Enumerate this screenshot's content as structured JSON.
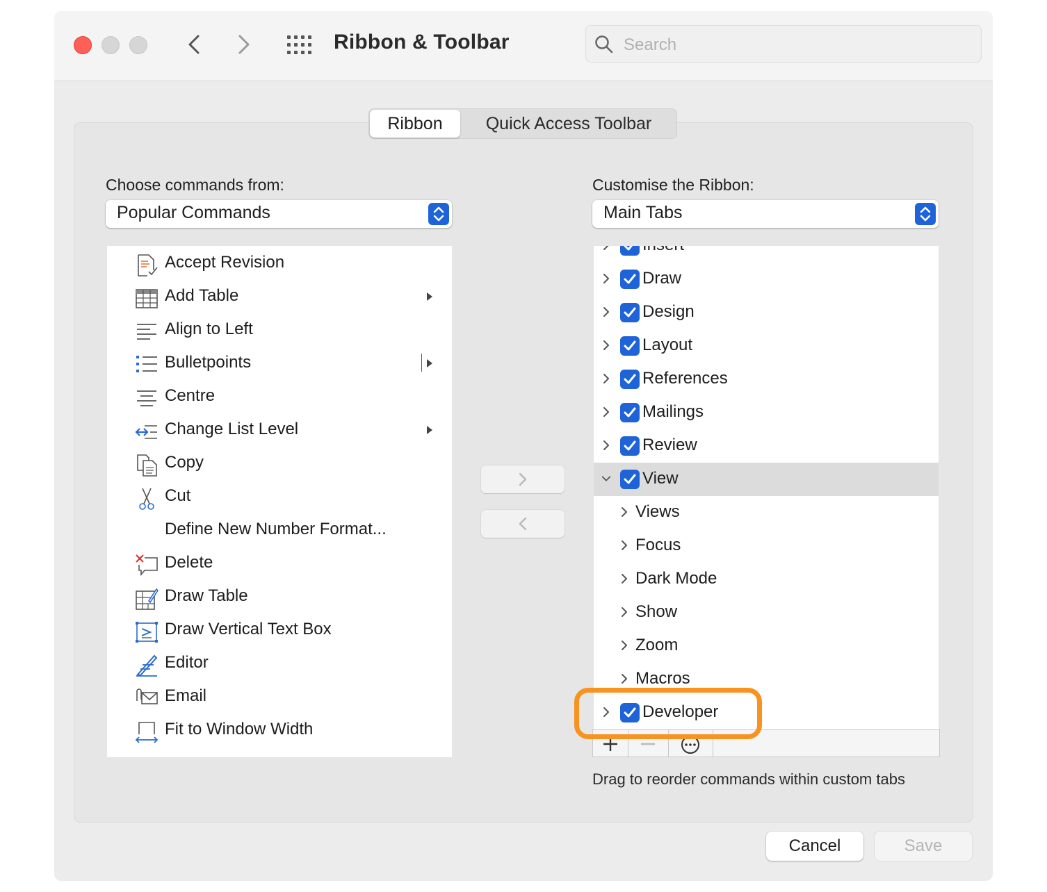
{
  "window": {
    "title": "Ribbon & Toolbar"
  },
  "search": {
    "placeholder": "Search"
  },
  "tabs": [
    {
      "label": "Ribbon",
      "active": true
    },
    {
      "label": "Quick Access Toolbar",
      "active": false
    }
  ],
  "left": {
    "label": "Choose commands from:",
    "dropdown_value": "Popular Commands",
    "commands": [
      {
        "label": "Accept Revision",
        "icon": "accept-revision-icon"
      },
      {
        "label": "Add Table",
        "icon": "table-icon",
        "submenu": true
      },
      {
        "label": "Align to Left",
        "icon": "align-left-icon"
      },
      {
        "label": "Bulletpoints",
        "icon": "bullets-icon",
        "split_submenu": true
      },
      {
        "label": "Centre",
        "icon": "align-center-icon"
      },
      {
        "label": "Change List Level",
        "icon": "list-level-icon",
        "submenu": true
      },
      {
        "label": "Copy",
        "icon": "copy-icon"
      },
      {
        "label": "Cut",
        "icon": "scissors-icon"
      },
      {
        "label": "Define New Number Format...",
        "icon": ""
      },
      {
        "label": "Delete",
        "icon": "delete-comment-icon"
      },
      {
        "label": "Draw Table",
        "icon": "draw-table-icon"
      },
      {
        "label": "Draw Vertical Text Box",
        "icon": "vertical-text-box-icon"
      },
      {
        "label": "Editor",
        "icon": "editor-icon"
      },
      {
        "label": "Email",
        "icon": "email-icon"
      },
      {
        "label": "Fit to Window Width",
        "icon": "fit-width-icon"
      }
    ]
  },
  "right": {
    "label": "Customise the Ribbon:",
    "dropdown_value": "Main Tabs",
    "tabs": [
      {
        "label": "Insert",
        "checked": true,
        "level": 0
      },
      {
        "label": "Draw",
        "checked": true,
        "level": 0
      },
      {
        "label": "Design",
        "checked": true,
        "level": 0
      },
      {
        "label": "Layout",
        "checked": true,
        "level": 0
      },
      {
        "label": "References",
        "checked": true,
        "level": 0
      },
      {
        "label": "Mailings",
        "checked": true,
        "level": 0
      },
      {
        "label": "Review",
        "checked": true,
        "level": 0
      },
      {
        "label": "View",
        "checked": true,
        "level": 0,
        "expanded": true,
        "selected": true
      },
      {
        "label": "Views",
        "level": 1
      },
      {
        "label": "Focus",
        "level": 1
      },
      {
        "label": "Dark Mode",
        "level": 1
      },
      {
        "label": "Show",
        "level": 1
      },
      {
        "label": "Zoom",
        "level": 1
      },
      {
        "label": "Macros",
        "level": 1
      },
      {
        "label": "Developer",
        "checked": true,
        "level": 0,
        "highlighted": true
      }
    ],
    "hint": "Drag to reorder commands within custom tabs"
  },
  "buttons": {
    "cancel": "Cancel",
    "save": "Save"
  },
  "colors": {
    "accent": "#1f63d8",
    "highlight": "#f7931e",
    "close": "#fe5f57"
  }
}
